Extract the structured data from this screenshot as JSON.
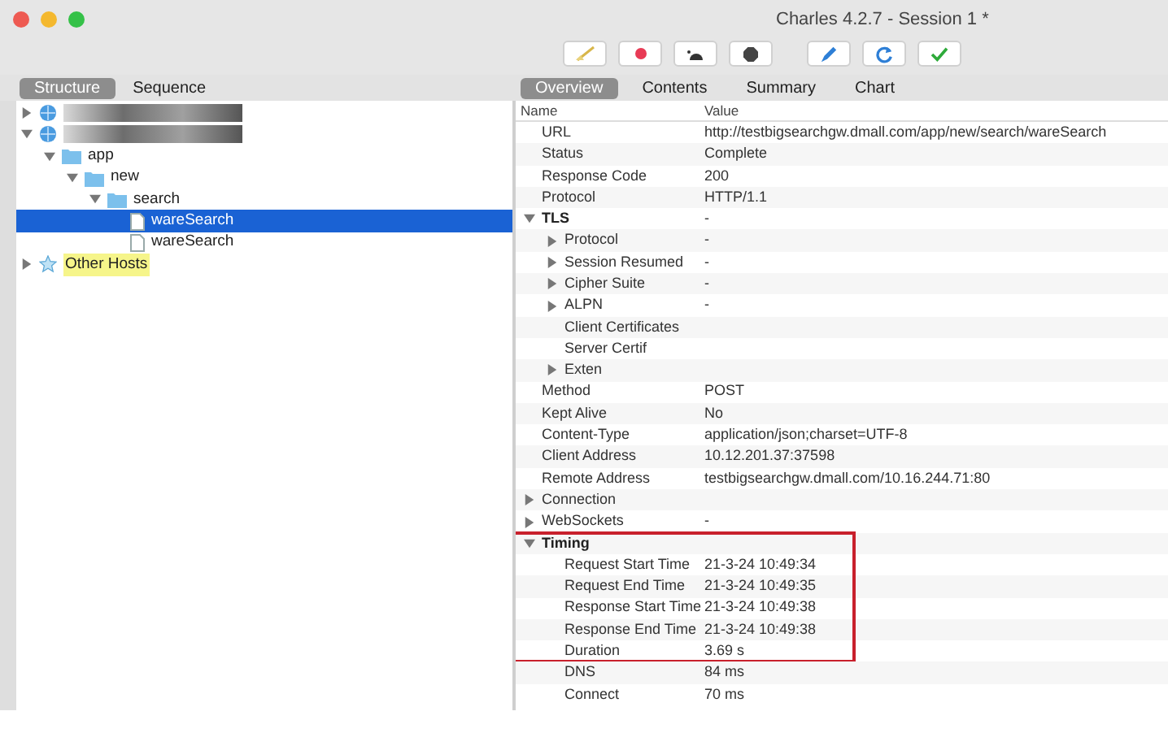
{
  "window": {
    "title": "Charles 4.2.7 - Session 1 *"
  },
  "toolbar": [
    {
      "kind": "broom"
    },
    {
      "kind": "record"
    },
    {
      "kind": "turtle"
    },
    {
      "kind": "stop"
    },
    {
      "kind": "pen"
    },
    {
      "kind": "refresh"
    },
    {
      "kind": "check"
    }
  ],
  "left_tabs": [
    {
      "label": "Structure",
      "selected": true
    },
    {
      "label": "Sequence",
      "selected": false
    }
  ],
  "right_tabs": [
    {
      "label": "Overview",
      "selected": true
    },
    {
      "label": "Contents",
      "selected": false
    },
    {
      "label": "Summary",
      "selected": false
    },
    {
      "label": "Chart",
      "selected": false
    }
  ],
  "tree": [
    {
      "kind": "host",
      "redacted": true,
      "expanded": false,
      "selected": false
    },
    {
      "kind": "host",
      "redacted": true,
      "expanded": true,
      "selected": false,
      "children": [
        {
          "kind": "folder",
          "label": "app",
          "expanded": true,
          "selected": false,
          "children": [
            {
              "kind": "folder",
              "label": "new",
              "expanded": true,
              "selected": false,
              "children": [
                {
                  "kind": "folder",
                  "label": "search",
                  "expanded": true,
                  "selected": false,
                  "children": [
                    {
                      "kind": "file",
                      "label": "wareSearch",
                      "selected": true
                    },
                    {
                      "kind": "file",
                      "label": "wareSearch",
                      "selected": false
                    }
                  ]
                }
              ]
            }
          ]
        }
      ]
    },
    {
      "kind": "other",
      "label": "Other Hosts",
      "expanded": false,
      "selected": false
    }
  ],
  "overview": {
    "columns": [
      "Name",
      "Value"
    ],
    "rows": [
      {
        "name": "URL",
        "value": "http://testbigsearchgw.dmall.com/app/new/search/wareSearch"
      },
      {
        "name": "Status",
        "value": "Complete"
      },
      {
        "name": "Response Code",
        "value": "200"
      },
      {
        "name": "Protocol",
        "value": "HTTP/1.1"
      },
      {
        "name": "TLS",
        "value": "-",
        "bold": true,
        "expanded": true,
        "children": [
          {
            "name": "Protocol",
            "value": "-",
            "expanded": false
          },
          {
            "name": "Session Resumed",
            "value": "-",
            "expanded": false
          },
          {
            "name": "Cipher Suite",
            "value": "-",
            "expanded": false
          },
          {
            "name": "ALPN",
            "value": "-",
            "expanded": false
          },
          {
            "name": "Client Certificates"
          },
          {
            "name": "Server Certif"
          },
          {
            "name": "Exten",
            "expanded": false
          }
        ]
      },
      {
        "name": "Method",
        "value": "POST"
      },
      {
        "name": "Kept Alive",
        "value": "No"
      },
      {
        "name": "Content-Type",
        "value": "application/json;charset=UTF-8"
      },
      {
        "name": "Client Address",
        "value": "10.12.201.37:37598"
      },
      {
        "name": "Remote Address",
        "value": "testbigsearchgw.dmall.com/10.16.244.71:80"
      },
      {
        "name": "Connection",
        "expanded": false
      },
      {
        "name": "WebSockets",
        "value": "-",
        "expanded": false
      },
      {
        "name": "Timing",
        "bold": true,
        "expanded": true,
        "highlighted": true,
        "children": [
          {
            "name": "Request Start Time",
            "value": "21-3-24 10:49:34",
            "highlighted": true
          },
          {
            "name": "Request End Time",
            "value": "21-3-24 10:49:35",
            "highlighted": true
          },
          {
            "name": "Response Start Time",
            "value": "21-3-24 10:49:38",
            "highlighted": true
          },
          {
            "name": "Response End Time",
            "value": "21-3-24 10:49:38",
            "highlighted": true
          },
          {
            "name": "Duration",
            "value": "3.69 s",
            "highlighted": true
          },
          {
            "name": "DNS",
            "value": "84 ms",
            "highlighted": false
          },
          {
            "name": "Connect",
            "value": "70 ms",
            "highlighted": false
          }
        ]
      }
    ]
  }
}
